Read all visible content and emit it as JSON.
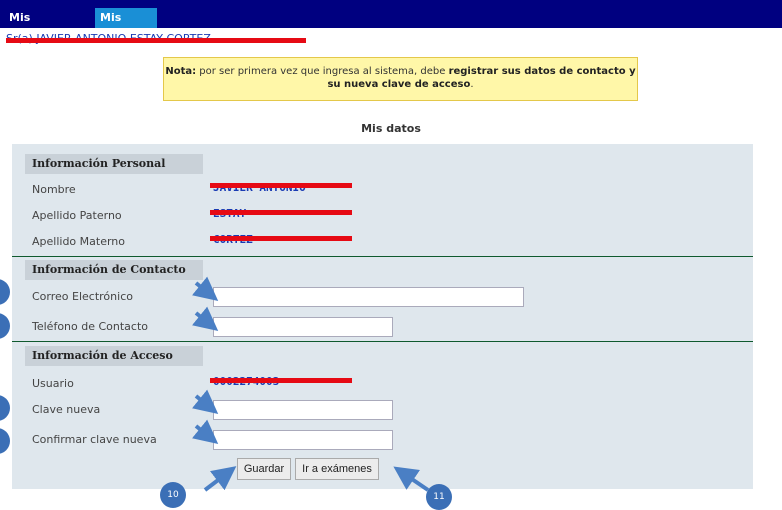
{
  "tabs": [
    {
      "label": "Mis exámenes",
      "active": false
    },
    {
      "label": "Mis datos",
      "active": true
    }
  ],
  "user_line": "Sr(a) JAVIER ANTONIO ESTAY CORTEZ",
  "note": {
    "prefix": "Nota:",
    "text1": " por ser primera vez que ingresa al sistema, debe ",
    "bold1": "registrar sus datos de contacto y su nueva clave de acceso",
    "suffix": "."
  },
  "page_title": "Mis datos",
  "sections": {
    "personal": {
      "title": "Información Personal",
      "nombre_label": "Nombre",
      "nombre_value": "JAVIER ANTONIO",
      "paterno_label": "Apellido Paterno",
      "paterno_value": "ESTAY",
      "materno_label": "Apellido Materno",
      "materno_value": "CORTEZ"
    },
    "contacto": {
      "title": "Información de Contacto",
      "email_label": "Correo Electrónico",
      "email_value": "",
      "phone_label": "Teléfono de Contacto",
      "phone_value": ""
    },
    "acceso": {
      "title": "Información de Acceso",
      "usuario_label": "Usuario",
      "usuario_value": "0002274003",
      "clave_label": "Clave nueva",
      "clave_value": "",
      "confirmar_label": "Confirmar clave nueva",
      "confirmar_value": ""
    }
  },
  "buttons": {
    "guardar": "Guardar",
    "ir_examenes": "Ir a exámenes"
  },
  "callouts": {
    "guardar_number": "10",
    "examenes_number": "11"
  },
  "colors": {
    "topbar": "#000080",
    "active_tab": "#1a8fd6",
    "panel": "#dfe7ed",
    "redaction": "#e60a14",
    "callout": "#3b6fb6"
  }
}
